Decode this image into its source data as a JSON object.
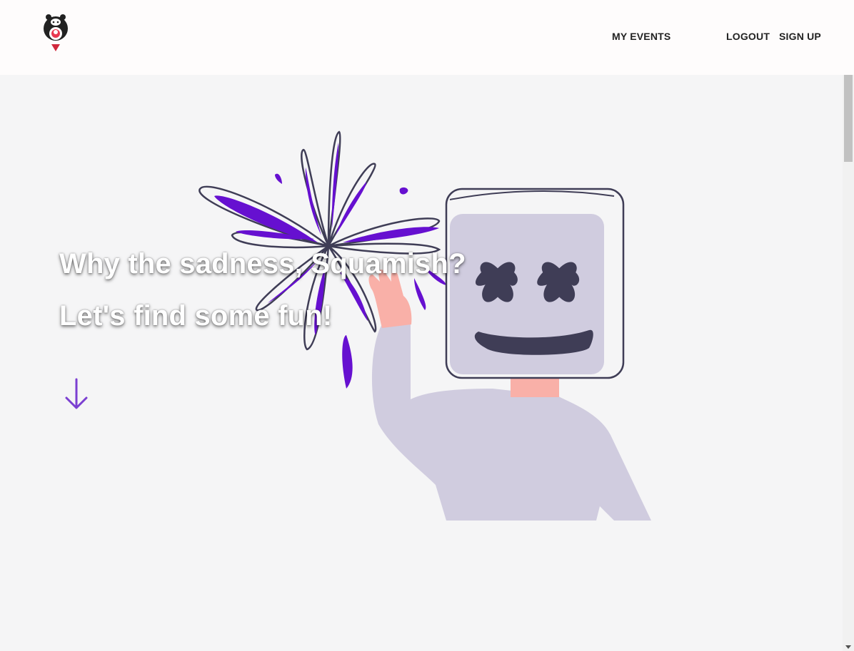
{
  "header": {
    "logo_icon": "bear-logo-icon",
    "nav": {
      "my_events": "MY EVENTS",
      "logout": "LOGOUT",
      "sign_up": "SIGN UP"
    }
  },
  "hero": {
    "line1": "Why the sadness, Squamish?",
    "line2": "Let's find some fun!",
    "scroll_icon": "arrow-down-icon",
    "illustration": "marshmello-fireworks-illustration"
  },
  "colors": {
    "accent": "#6610d0",
    "header_bg": "#fefcfc",
    "page_bg": "#f5f5f6",
    "figure": "#d0ccdf",
    "figure_dark": "#3f3d56"
  }
}
